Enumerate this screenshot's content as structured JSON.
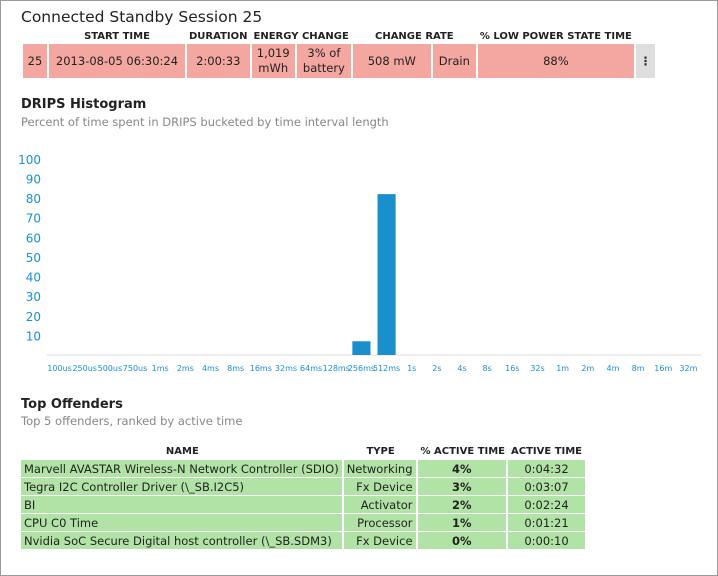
{
  "session": {
    "title": "Connected Standby Session 25",
    "headers": [
      "",
      "START TIME",
      "DURATION",
      "ENERGY CHANGE",
      "",
      "CHANGE RATE",
      "",
      "% LOW POWER STATE TIME"
    ],
    "row": {
      "id": "25",
      "start_time": "2013-08-05  06:30:24",
      "duration": "2:00:33",
      "energy": "1,019 mWh",
      "battery": "3% of battery",
      "rate": "508 mW",
      "direction": "Drain",
      "low_power_pct": "88%",
      "menu": "⋮"
    }
  },
  "histogram": {
    "title": "DRIPS Histogram",
    "subtitle": "Percent of time spent in DRIPS bucketed by time interval length"
  },
  "chart_data": {
    "type": "bar",
    "categories": [
      "100us",
      "250us",
      "500us",
      "750us",
      "1ms",
      "2ms",
      "4ms",
      "8ms",
      "16ms",
      "32ms",
      "64ms",
      "128ms",
      "256ms",
      "512ms",
      "1s",
      "2s",
      "4s",
      "8s",
      "16s",
      "32s",
      "1m",
      "2m",
      "4m",
      "8m",
      "16m",
      "32m"
    ],
    "values": [
      0,
      0,
      0,
      0,
      0,
      0,
      0,
      0,
      0,
      0,
      0,
      0,
      7,
      82,
      0,
      0,
      0,
      0,
      0,
      0,
      0,
      0,
      0,
      0,
      0,
      0
    ],
    "yticks": [
      10,
      20,
      30,
      40,
      50,
      60,
      70,
      80,
      90,
      100
    ],
    "ylim": [
      0,
      105
    ],
    "title": "",
    "xlabel": "",
    "ylabel": "",
    "grid": false,
    "colors": {
      "bar": "#1a8fcb",
      "axis_text": "#1a90d8",
      "baseline": "#dddddd"
    }
  },
  "offenders": {
    "title": "Top Offenders",
    "subtitle": "Top 5 offenders, ranked by active time",
    "headers": [
      "NAME",
      "TYPE",
      "% ACTIVE TIME",
      "ACTIVE TIME"
    ],
    "rows": [
      {
        "name": "Marvell AVASTAR Wireless-N Network Controller (SDIO)",
        "type": "Networking",
        "pct": "4%",
        "time": "0:04:32"
      },
      {
        "name": "Tegra I2C Controller Driver (\\_SB.I2C5)",
        "type": "Fx Device",
        "pct": "3%",
        "time": "0:03:07"
      },
      {
        "name": "BI",
        "type": "Activator",
        "pct": "2%",
        "time": "0:02:24"
      },
      {
        "name": "CPU C0 Time",
        "type": "Processor",
        "pct": "1%",
        "time": "0:01:21"
      },
      {
        "name": "Nvidia SoC Secure Digital host controller (\\_SB.SDM3)",
        "type": "Fx Device",
        "pct": "0%",
        "time": "0:00:10"
      }
    ]
  }
}
